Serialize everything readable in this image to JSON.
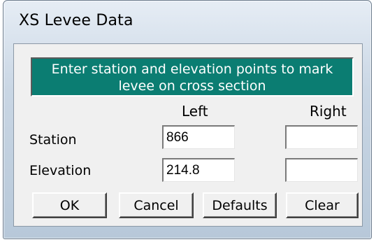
{
  "window": {
    "title": "XS Levee Data"
  },
  "message": {
    "line1": "Enter station and elevation points to mark",
    "line2": "levee on cross section",
    "background_color": "#0b7d72"
  },
  "columns": {
    "left": "Left",
    "right": "Right"
  },
  "rows": {
    "station": {
      "label": "Station",
      "left_value": "866",
      "right_value": ""
    },
    "elevation": {
      "label": "Elevation",
      "left_value": "214.8",
      "right_value": ""
    }
  },
  "buttons": {
    "ok": "OK",
    "cancel": "Cancel",
    "defaults": "Defaults",
    "clear": "Clear"
  }
}
